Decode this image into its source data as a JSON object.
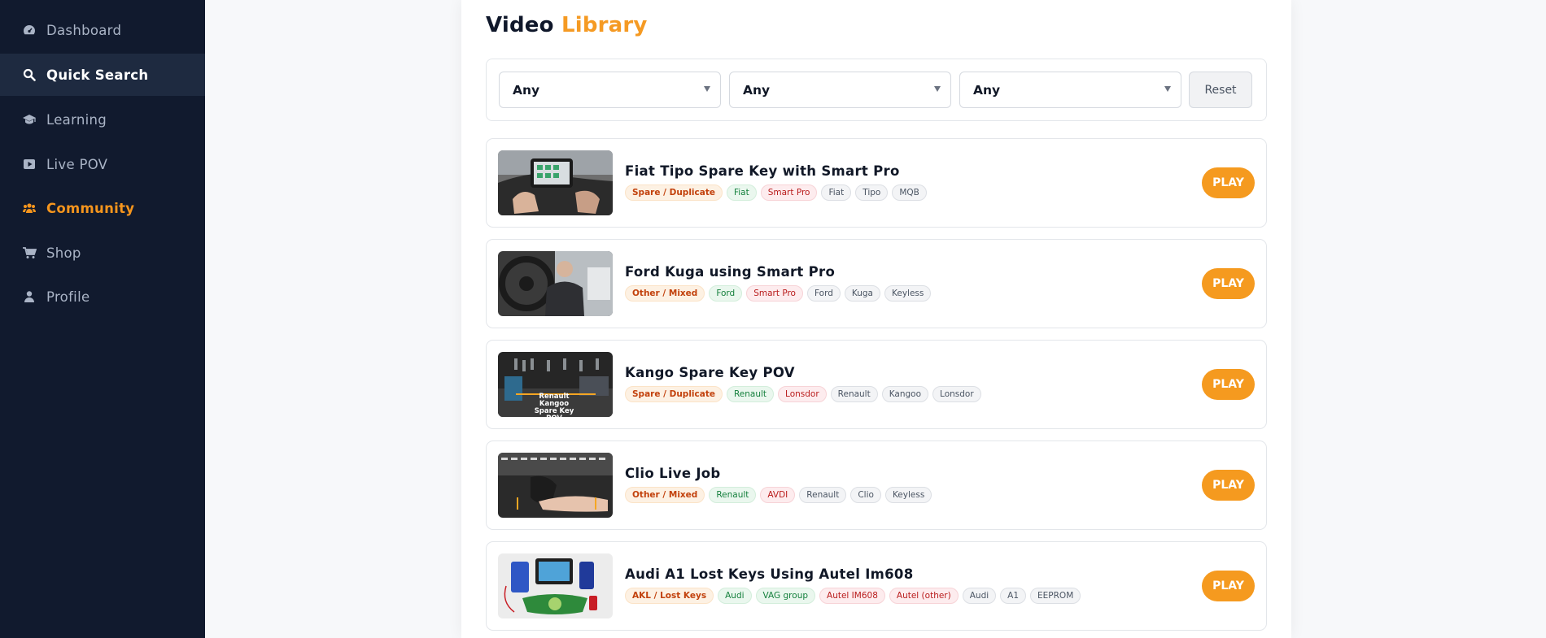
{
  "sidebar": {
    "items": [
      {
        "label": "Dashboard",
        "icon": "dashboard-gauge-icon"
      },
      {
        "label": "Quick Search",
        "icon": "search-icon"
      },
      {
        "label": "Learning",
        "icon": "graduation-cap-icon"
      },
      {
        "label": "Live POV",
        "icon": "play-icon"
      },
      {
        "label": "Community",
        "icon": "users-group-icon"
      },
      {
        "label": "Shop",
        "icon": "cart-icon"
      },
      {
        "label": "Profile",
        "icon": "user-icon"
      }
    ],
    "active_item": "Quick Search",
    "highlighted_item": "Community"
  },
  "main": {
    "title_part1": "Video",
    "title_part2": "Library",
    "filters": {
      "select1": "Any",
      "select2": "Any",
      "select3": "Any",
      "reset_label": "Reset"
    },
    "play_label": "PLAY",
    "videos": [
      {
        "title": "Fiat Tipo Spare Key with Smart Pro",
        "thumbnail": "car-dashboard-tablet",
        "tags": [
          {
            "text": "Spare / Duplicate",
            "kind": "category"
          },
          {
            "text": "Fiat",
            "kind": "make"
          },
          {
            "text": "Smart Pro",
            "kind": "tool"
          },
          {
            "text": "Fiat",
            "kind": "general"
          },
          {
            "text": "Tipo",
            "kind": "general"
          },
          {
            "text": "MQB",
            "kind": "general"
          }
        ]
      },
      {
        "title": "Ford Kuga using Smart Pro",
        "thumbnail": "technician-in-car",
        "tags": [
          {
            "text": "Other / Mixed",
            "kind": "category"
          },
          {
            "text": "Ford",
            "kind": "make"
          },
          {
            "text": "Smart Pro",
            "kind": "tool"
          },
          {
            "text": "Ford",
            "kind": "general"
          },
          {
            "text": "Kuga",
            "kind": "general"
          },
          {
            "text": "Keyless",
            "kind": "general"
          }
        ]
      },
      {
        "title": "Kango Spare Key POV",
        "thumbnail": "workbench-keys",
        "thumbnail_caption_line1": "Renault Kangoo",
        "thumbnail_caption_line2": "Spare Key POV",
        "tags": [
          {
            "text": "Spare / Duplicate",
            "kind": "category"
          },
          {
            "text": "Renault",
            "kind": "make"
          },
          {
            "text": "Lonsdor",
            "kind": "tool"
          },
          {
            "text": "Renault",
            "kind": "general"
          },
          {
            "text": "Kangoo",
            "kind": "general"
          },
          {
            "text": "Lonsdor",
            "kind": "general"
          }
        ]
      },
      {
        "title": "Clio Live Job",
        "thumbnail": "key-fob-in-hand",
        "tags": [
          {
            "text": "Other / Mixed",
            "kind": "category"
          },
          {
            "text": "Renault",
            "kind": "make"
          },
          {
            "text": "AVDI",
            "kind": "tool"
          },
          {
            "text": "Renault",
            "kind": "general"
          },
          {
            "text": "Clio",
            "kind": "general"
          },
          {
            "text": "Keyless",
            "kind": "general"
          }
        ]
      },
      {
        "title": "Audi A1 Lost Keys Using Autel Im608",
        "thumbnail": "diagnostic-tools-on-white",
        "tags": [
          {
            "text": "AKL / Lost Keys",
            "kind": "category"
          },
          {
            "text": "Audi",
            "kind": "make"
          },
          {
            "text": "VAG group",
            "kind": "make"
          },
          {
            "text": "Autel IM608",
            "kind": "tool"
          },
          {
            "text": "Autel (other)",
            "kind": "tool"
          },
          {
            "text": "Audi",
            "kind": "general"
          },
          {
            "text": "A1",
            "kind": "general"
          },
          {
            "text": "EEPROM",
            "kind": "general"
          }
        ]
      }
    ]
  },
  "colors": {
    "sidebar_bg": "#111a2e",
    "accent": "#f59a1f",
    "active_item_bg": "#1e2a40"
  }
}
